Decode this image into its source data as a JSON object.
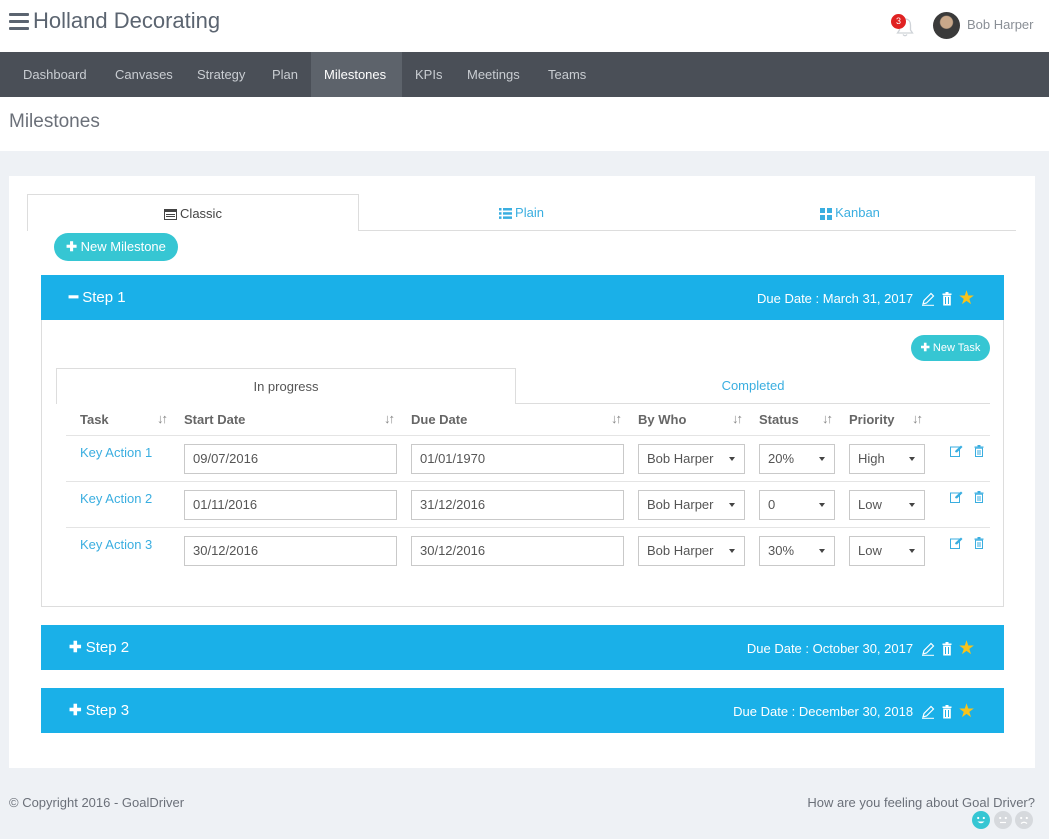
{
  "app": {
    "title": "Holland Decorating"
  },
  "header": {
    "notification_count": "3",
    "user_name": "Bob Harper"
  },
  "nav": {
    "items": [
      {
        "label": "Dashboard",
        "active": false
      },
      {
        "label": "Canvases",
        "active": false
      },
      {
        "label": "Strategy",
        "active": false
      },
      {
        "label": "Plan",
        "active": false
      },
      {
        "label": "Milestones",
        "active": true
      },
      {
        "label": "KPIs",
        "active": false
      },
      {
        "label": "Meetings",
        "active": false
      },
      {
        "label": "Teams",
        "active": false
      }
    ]
  },
  "page": {
    "title": "Milestones"
  },
  "view_tabs": {
    "classic": "Classic",
    "plain": "Plain",
    "kanban": "Kanban",
    "selected": "Classic"
  },
  "new_milestone_label": "New Milestone",
  "steps": [
    {
      "title": "Step 1",
      "expanded": true,
      "due": "Due Date : March 31, 2017"
    },
    {
      "title": "Step 2",
      "expanded": false,
      "due": "Due Date : October 30, 2017"
    },
    {
      "title": "Step 3",
      "expanded": false,
      "due": "Due Date : December 30, 2018"
    }
  ],
  "step1": {
    "new_task_label": "New Task",
    "subtabs": {
      "in_progress": "In progress",
      "completed": "Completed",
      "selected": "In progress"
    },
    "columns": [
      "Task",
      "Start Date",
      "Due Date",
      "By Who",
      "Status",
      "Priority"
    ],
    "tasks": [
      {
        "task": "Key Action 1",
        "start": "09/07/2016",
        "due": "01/01/1970",
        "by_who": "Bob Harper",
        "status": "20%",
        "priority": "High"
      },
      {
        "task": "Key Action 2",
        "start": "01/11/2016",
        "due": "31/12/2016",
        "by_who": "Bob Harper",
        "status": "0",
        "priority": "Low"
      },
      {
        "task": "Key Action 3",
        "start": "30/12/2016",
        "due": "30/12/2016",
        "by_who": "Bob Harper",
        "status": "30%",
        "priority": "Low"
      }
    ]
  },
  "footer": {
    "copyright": "© Copyright 2016 - GoalDriver",
    "feedback_question": "How are you feeling about Goal Driver?"
  },
  "colors": {
    "accent": "#1ab0e8",
    "button": "#36c6d3",
    "navbar": "#4a4f57",
    "star": "#f7c31b",
    "badge": "#e02222"
  }
}
